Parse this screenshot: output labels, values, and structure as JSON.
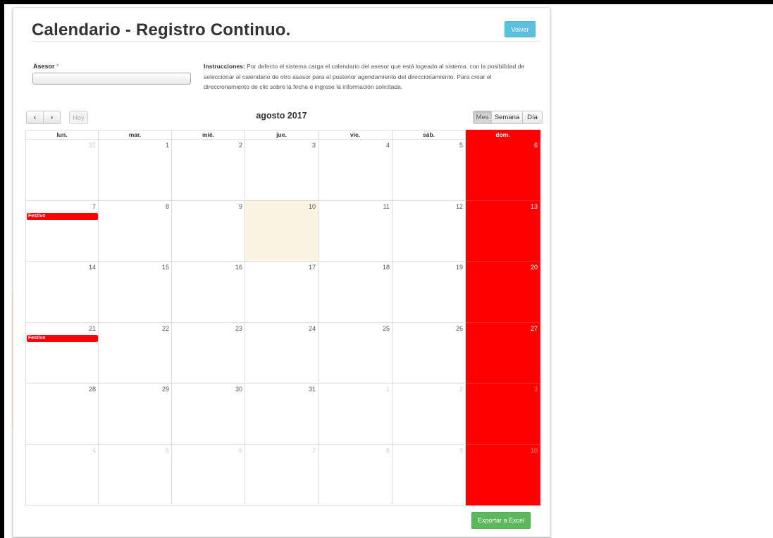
{
  "page": {
    "title": "Calendario - Registro Continuo.",
    "back_label": "Volver",
    "export_label": "Exportar a Excel"
  },
  "asesor": {
    "label": "Asesor",
    "required_mark": "*",
    "selected_value": ""
  },
  "instructions": {
    "label": "Instrucciones:",
    "text": " Por defecto el sistema carga el calendario del asesor que está logeado al sistema, con la posibilidad de seleccionar el calendario de otro asesor para el posterior agendamiento del direccionamiento. Para crear el direccionamiento de clic sobre la fecha e ingrese la información solicitada."
  },
  "toolbar": {
    "prev_icon": "‹",
    "next_icon": "›",
    "today_label": "Hoy",
    "month_title": "agosto 2017",
    "views": [
      "Mes",
      "Semana",
      "Día"
    ],
    "active_view": "Mes"
  },
  "calendar": {
    "weekdays": [
      "lun.",
      "mar.",
      "mié.",
      "jue.",
      "vie.",
      "sáb.",
      "dom."
    ],
    "weeks": [
      [
        "31",
        "1",
        "2",
        "3",
        "4",
        "5",
        "6"
      ],
      [
        "7",
        "8",
        "9",
        "10",
        "11",
        "12",
        "13"
      ],
      [
        "14",
        "15",
        "16",
        "17",
        "18",
        "19",
        "20"
      ],
      [
        "21",
        "22",
        "23",
        "24",
        "25",
        "26",
        "27"
      ],
      [
        "28",
        "29",
        "30",
        "31",
        "1",
        "2",
        "3"
      ],
      [
        "4",
        "5",
        "6",
        "7",
        "8",
        "9",
        "10"
      ]
    ],
    "other_month_cells": [
      [
        0,
        0
      ],
      [
        4,
        4
      ],
      [
        4,
        5
      ],
      [
        4,
        6
      ],
      [
        5,
        0
      ],
      [
        5,
        1
      ],
      [
        5,
        2
      ],
      [
        5,
        3
      ],
      [
        5,
        4
      ],
      [
        5,
        5
      ],
      [
        5,
        6
      ]
    ],
    "today_cell": [
      1,
      3
    ],
    "events": [
      {
        "week": 1,
        "day": 0,
        "label": "Festivo"
      },
      {
        "week": 3,
        "day": 0,
        "label": "Festivo"
      }
    ],
    "colors": {
      "sunday": "#ff0000",
      "event": "#ff0000",
      "today": "#fcf4e2"
    }
  }
}
